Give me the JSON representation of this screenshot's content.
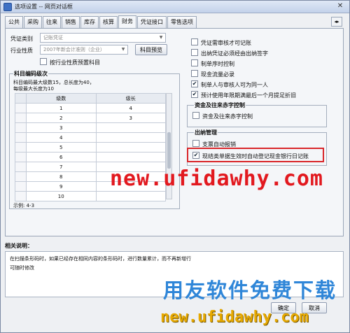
{
  "window": {
    "title": "选项设置 -- 网页对话框",
    "close_glyph": "✕"
  },
  "tabs": [
    {
      "label": "公共"
    },
    {
      "label": "采购"
    },
    {
      "label": "往来"
    },
    {
      "label": "销售"
    },
    {
      "label": "库存"
    },
    {
      "label": "核算"
    },
    {
      "label": "财务",
      "active": true
    },
    {
      "label": "凭证接口"
    },
    {
      "label": "零售选项"
    }
  ],
  "tab_scroll_glyph": "◂▸",
  "form": {
    "voucher_type_label": "凭证类别",
    "voucher_type_value": "记账凭证",
    "industry_label": "行业性质",
    "industry_value": "2007年新会计准则（企业）",
    "preset_button": "科目预览",
    "preset_checkbox": "按行业性质预置科目"
  },
  "coding": {
    "title": "科目编码级次",
    "info_line1": "科目编码最大级数15，总长度为40，",
    "info_line2": "每级最大长度为10",
    "columns": [
      "级数",
      "级长"
    ],
    "rows": [
      {
        "n": "1",
        "len": "4"
      },
      {
        "n": "2",
        "len": "3"
      },
      {
        "n": "3",
        "len": ""
      },
      {
        "n": "4",
        "len": ""
      },
      {
        "n": "5",
        "len": ""
      },
      {
        "n": "6",
        "len": ""
      },
      {
        "n": "7",
        "len": ""
      },
      {
        "n": "8",
        "len": ""
      },
      {
        "n": "9",
        "len": ""
      },
      {
        "n": "10",
        "len": ""
      }
    ],
    "example": "示例:  4-3"
  },
  "options": [
    {
      "label": "凭证需审核才可记账",
      "checked": false
    },
    {
      "label": "出纳凭证必须经由出纳签字",
      "checked": false
    },
    {
      "label": "制单序时控制",
      "checked": false
    },
    {
      "label": "现金流量必录",
      "checked": false
    },
    {
      "label": "制单人与审核人可为同一人",
      "checked": true
    },
    {
      "label": "预计使用年限期满最后一个月提足折旧",
      "checked": true
    }
  ],
  "funds_group": {
    "title": "资金及往来赤字控制",
    "checkbox": "资金及往来赤字控制",
    "checked": false
  },
  "cashier_group": {
    "title": "出纳管理",
    "items": [
      {
        "label": "支票自动报销",
        "checked": false
      },
      {
        "label": "现结类单据生效时自动登记现金银行日记账",
        "checked": true
      }
    ]
  },
  "description": {
    "heading": "相关说明：",
    "line1": "在扫描条形码时，如果已经存在相同内容的条形码时，进行数量累计，而不再新增行",
    "line2": "可随时修改"
  },
  "buttons": {
    "ok": "确定",
    "cancel": "取消"
  },
  "watermarks": {
    "top": "new.ufidawhy.com",
    "brand": "用友软件免费下载",
    "bottom": "new.ufidawhy.com"
  },
  "colors": {
    "highlight": "#d9262a",
    "watermark_red": "#e2191f",
    "watermark_blue": "#2f86d8",
    "watermark_gold": "#e7a900"
  }
}
